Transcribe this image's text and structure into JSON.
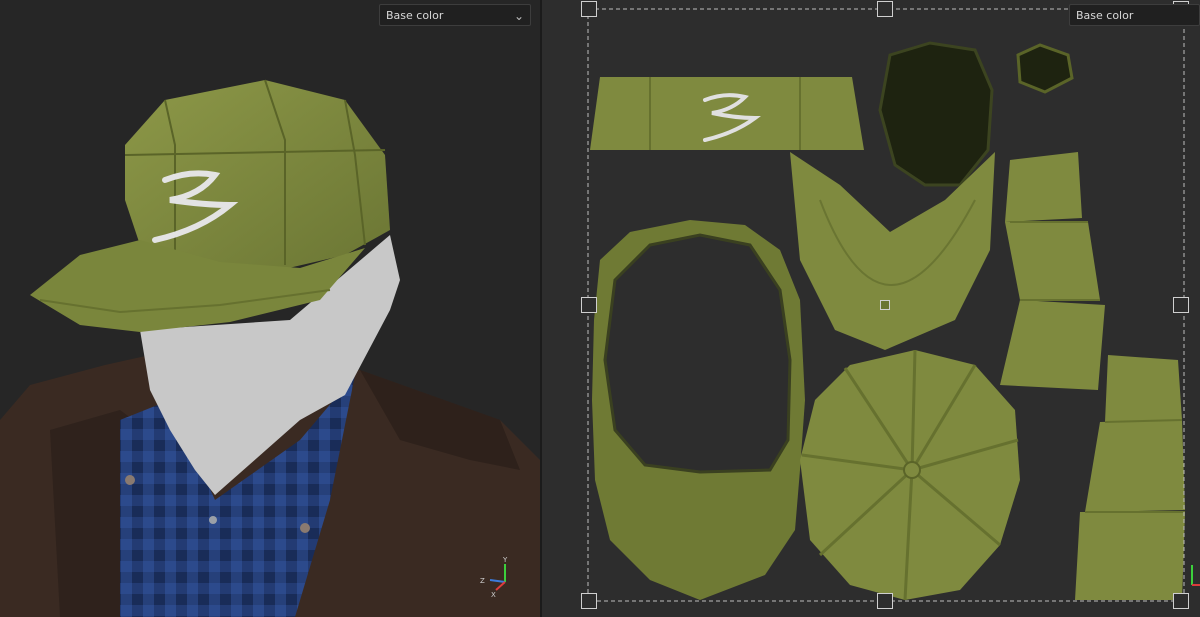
{
  "viewport_3d": {
    "channel_dropdown": {
      "selected": "Base color"
    },
    "axis_gizmo": {
      "y": "Y",
      "z": "Z",
      "x": "X"
    }
  },
  "viewport_2d": {
    "channel_dropdown": {
      "selected": "Base color"
    }
  },
  "colors": {
    "cap_green": "#7f8a3f",
    "cap_dark": "#5f6a2c",
    "jacket_brown": "#3a2a22",
    "shirt_blue": "#2c4a8c",
    "face_gray": "#c8c8c8"
  }
}
